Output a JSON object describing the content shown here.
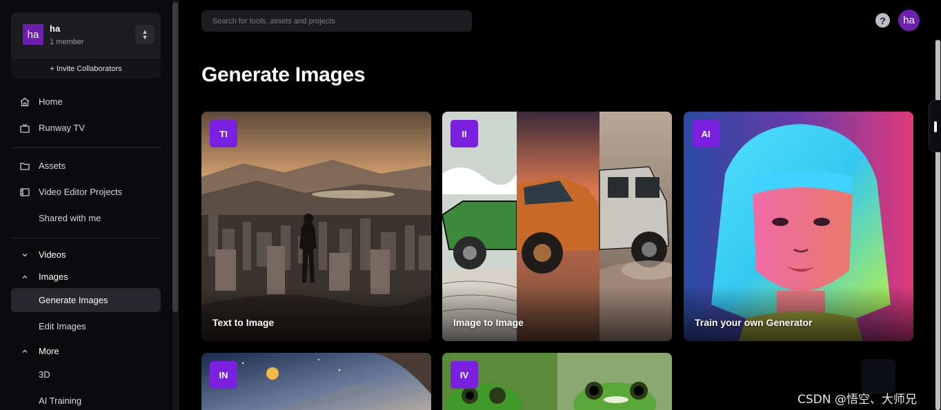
{
  "team": {
    "avatar_text": "ha",
    "name": "ha",
    "members": "1 member",
    "invite_label": "+ Invite Collaborators"
  },
  "nav": {
    "home": "Home",
    "runway_tv": "Runway TV",
    "assets": "Assets",
    "video_editor_projects": "Video Editor Projects",
    "shared_with_me": "Shared with me",
    "videos": "Videos",
    "images": "Images",
    "generate_images": "Generate Images",
    "edit_images": "Edit Images",
    "more": "More",
    "three_d": "3D",
    "ai_training": "AI Training"
  },
  "search": {
    "placeholder": "Search for tools, assets and projects"
  },
  "header": {
    "help_symbol": "?",
    "user_avatar_text": "ha"
  },
  "main": {
    "title": "Generate Images",
    "cards": [
      {
        "badge": "TI",
        "label": "Text to Image"
      },
      {
        "badge": "II",
        "label": "Image to Image"
      },
      {
        "badge": "AI",
        "label": "Train your own Generator"
      },
      {
        "badge": "IN",
        "label": ""
      },
      {
        "badge": "IV",
        "label": ""
      }
    ]
  },
  "watermark": "CSDN @悟空、大师兄",
  "colors": {
    "accent_purple": "#7b1fe0",
    "avatar_purple": "#6d1fb0",
    "background": "#000000",
    "sidebar": "#0b0b0d"
  }
}
